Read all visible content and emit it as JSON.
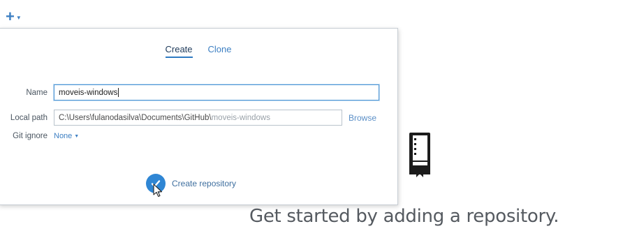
{
  "toolbar": {
    "add_icon": "plus-icon",
    "add_caret_icon": "chevron-down-icon"
  },
  "popover": {
    "tabs": [
      {
        "label": "Create",
        "active": true
      },
      {
        "label": "Clone",
        "active": false
      }
    ],
    "name": {
      "label": "Name",
      "value": "moveis-windows"
    },
    "local_path": {
      "label": "Local path",
      "value_base": "C:\\Users\\fulanodasilva\\Documents\\GitHub\\",
      "value_suffix": "moveis-windows",
      "browse_label": "Browse"
    },
    "git_ignore": {
      "label": "Git ignore",
      "value": "None"
    },
    "create_button": {
      "label": "Create repository",
      "icon": "check-icon"
    }
  },
  "empty_state": {
    "icon": "repository-book-icon",
    "message": "Get started by adding a repository."
  },
  "colors": {
    "accent": "#2f86d4",
    "link": "#3e80c3",
    "text": "#555a60",
    "border": "#c7cdd3"
  }
}
